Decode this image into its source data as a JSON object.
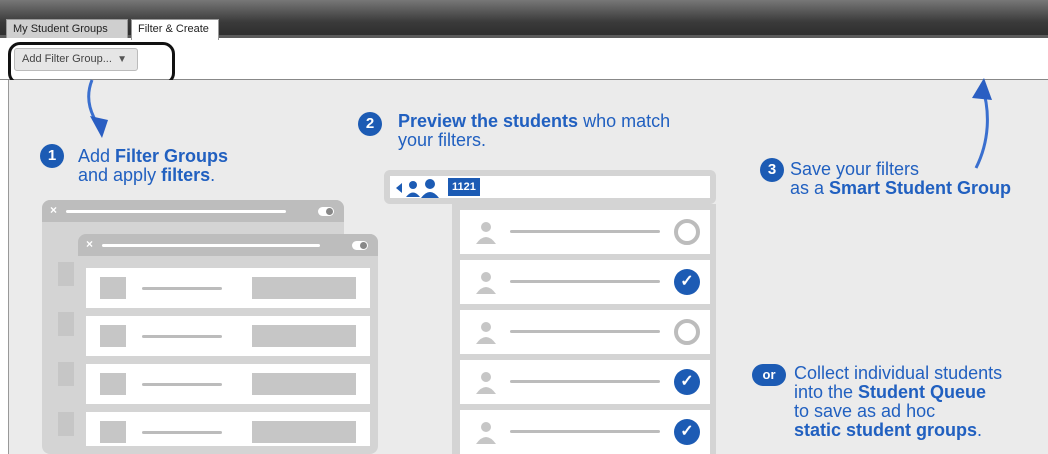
{
  "tabs": [
    {
      "label": "My Student Groups",
      "active": false
    },
    {
      "label": "Filter & Create",
      "active": true
    }
  ],
  "toolbar": {
    "filter_button_label": "Add Filter Group...",
    "caret": "▼"
  },
  "steps": {
    "one": {
      "number": "1",
      "line1_pre": "Add ",
      "line1_bold": "Filter Groups",
      "line2_pre": "and apply ",
      "line2_bold": "filters",
      "line2_post": "."
    },
    "two": {
      "number": "2",
      "line1_bold": "Preview the students",
      "line1_post": " who match",
      "line2": "your filters."
    },
    "three": {
      "number": "3",
      "line1": "Save your filters",
      "line2_pre": "as a ",
      "line2_bold": "Smart Student Group"
    },
    "or": {
      "pill": "or",
      "line1": "Collect individual students",
      "line2_pre": "into the ",
      "line2_bold": "Student Queue",
      "line3": "to save as ad hoc",
      "line4_bold": "static student groups",
      "line4_post": "."
    }
  },
  "preview": {
    "count": "1121"
  },
  "students": [
    {
      "checked": false
    },
    {
      "checked": true
    },
    {
      "checked": false
    },
    {
      "checked": true
    },
    {
      "checked": true
    }
  ],
  "icons": {
    "checkmark": "✓",
    "close": "×"
  },
  "colors": {
    "accent": "#1c5bb4",
    "text_blue": "#2160c0",
    "panel_gray": "#d4d4d4"
  }
}
